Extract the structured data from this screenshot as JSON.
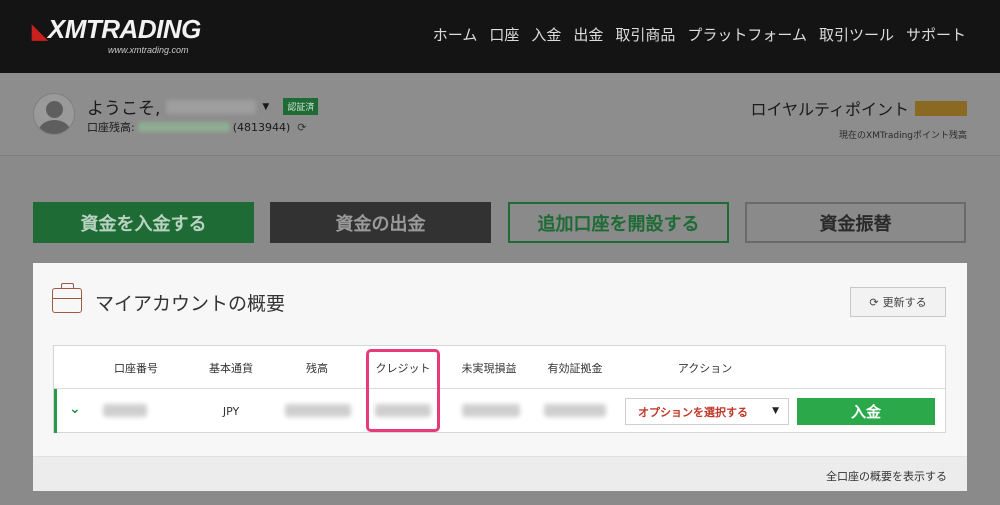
{
  "header": {
    "logo_text": "XMTRADING",
    "logo_mark": "◣",
    "logo_subtext": "www.xmtrading.com",
    "nav": [
      "ホーム",
      "口座",
      "入金",
      "出金",
      "取引商品",
      "プラットフォーム",
      "取引ツール",
      "サポート"
    ]
  },
  "user": {
    "welcome": "ようこそ,",
    "verified_badge": "認証済",
    "balance_label": "口座残高:",
    "account_number_display": "(4813944)"
  },
  "loyalty": {
    "title": "ロイヤルティポイント",
    "subtitle": "現在のXMTradingポイント残高"
  },
  "actions": {
    "deposit": "資金を入金する",
    "withdraw": "資金の出金",
    "open_account": "追加口座を開設する",
    "transfer": "資金振替"
  },
  "overview": {
    "title": "マイアカウントの概要",
    "refresh_label": "更新する",
    "columns": [
      "口座番号",
      "基本通貨",
      "残高",
      "クレジット",
      "未実現損益",
      "有効証拠金",
      "アクション"
    ],
    "row": {
      "currency": "JPY",
      "action_select": "オプションを選択する",
      "deposit_button": "入金"
    },
    "footer_link": "全口座の概要を表示する"
  },
  "colors": {
    "brand_green": "#2aa84a",
    "highlight": "#e83a7a",
    "accent_red": "#c0392b"
  }
}
